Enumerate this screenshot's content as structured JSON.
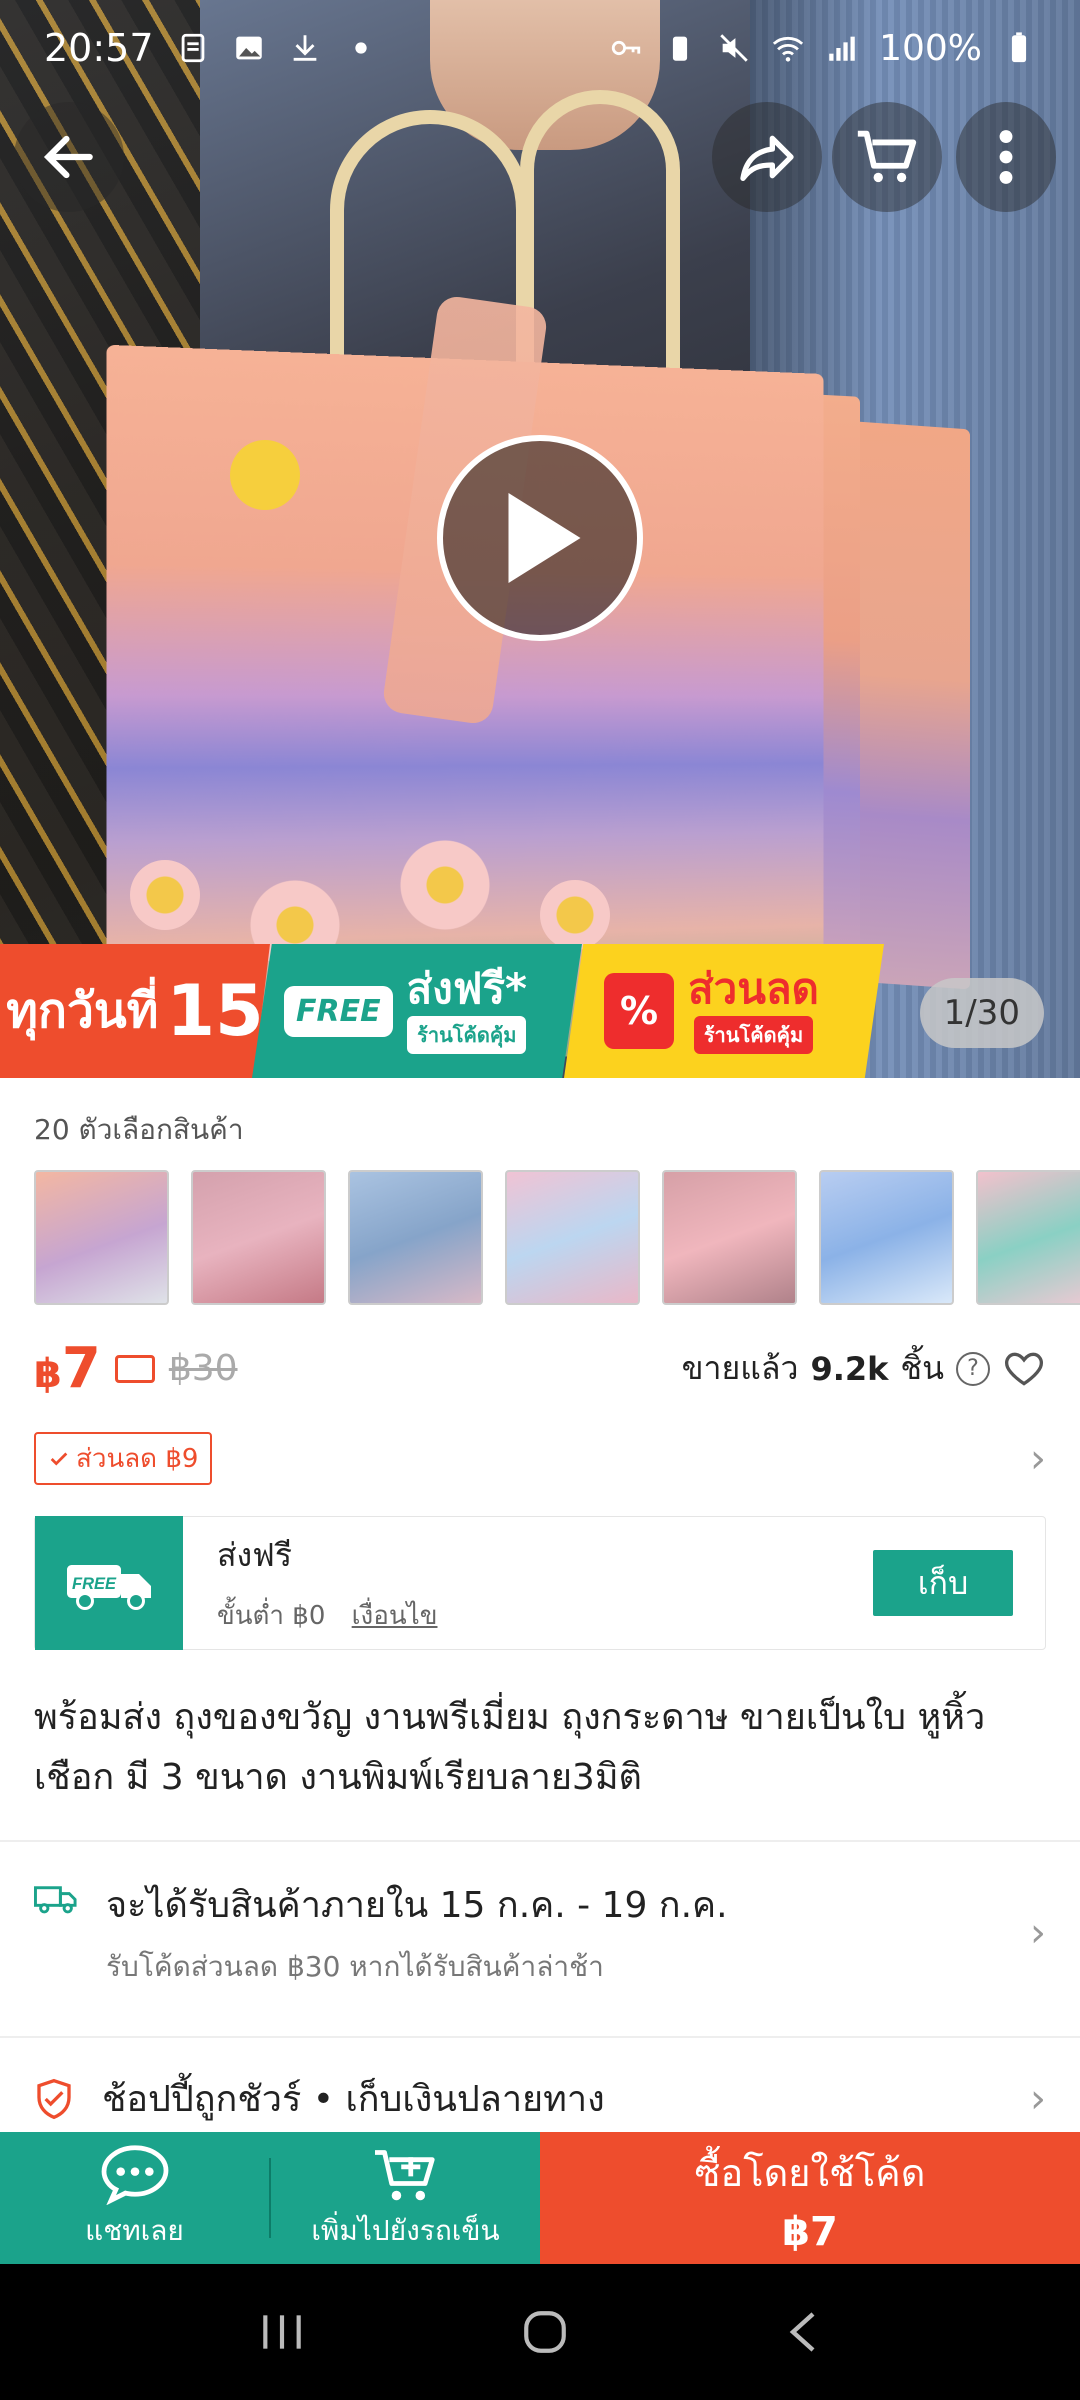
{
  "status_bar": {
    "time": "20:57",
    "battery": "100%"
  },
  "gallery": {
    "counter": "1/30"
  },
  "promo_banner": {
    "daily_label": "ทุกวันที่",
    "daily_number": "15",
    "free_badge": "FREE",
    "free_title": "ส่งฟรี*",
    "free_sub": "ร้านโค้ดคุ้ม",
    "discount_icon": "%",
    "discount_title": "ส่วนลด",
    "discount_sub": "ร้านโค้ดคุ้ม"
  },
  "product": {
    "variant_count": "20 ตัวเลือกสินค้า",
    "price_currency": "฿",
    "price_value": "7",
    "old_price": "฿30",
    "sold_prefix": "ขายแล้ว",
    "sold_count": "9.2k",
    "sold_suffix": "ชิ้น",
    "discount_tag": "ส่วนลด ฿9",
    "title": "พร้อมส่ง ถุงของขวัญ งานพรีเมี่ยม ถุงกระดาษ ขายเป็นใบ หูหิ้วเชือก มี 3 ขนาด งานพิมพ์เรียบลาย3มิติ"
  },
  "voucher": {
    "badge": "FREE",
    "title": "ส่งฟรี",
    "min_spend": "ขั้นต่ำ ฿0",
    "terms_link": "เงื่อนไข",
    "collect_button": "เก็บ"
  },
  "shipping": {
    "estimate": "จะได้รับสินค้าภายใน 15 ก.ค. - 19 ก.ค.",
    "late_voucher": "รับโค้ดส่วนลด ฿30 หากได้รับสินค้าล่าช้า"
  },
  "guarantee": {
    "text": "ช้อปปี้ถูกชัวร์ • เก็บเงินปลายทาง"
  },
  "bottom_bar": {
    "chat_label": "แชทเลย",
    "add_cart_label": "เพิ่มไปยังรถเข็น",
    "buy_line1": "ซื้อโดยใช้โค้ด",
    "buy_line2": "฿7"
  },
  "colors": {
    "brand_orange": "#ee4d2d",
    "brand_teal": "#1ba38b"
  }
}
